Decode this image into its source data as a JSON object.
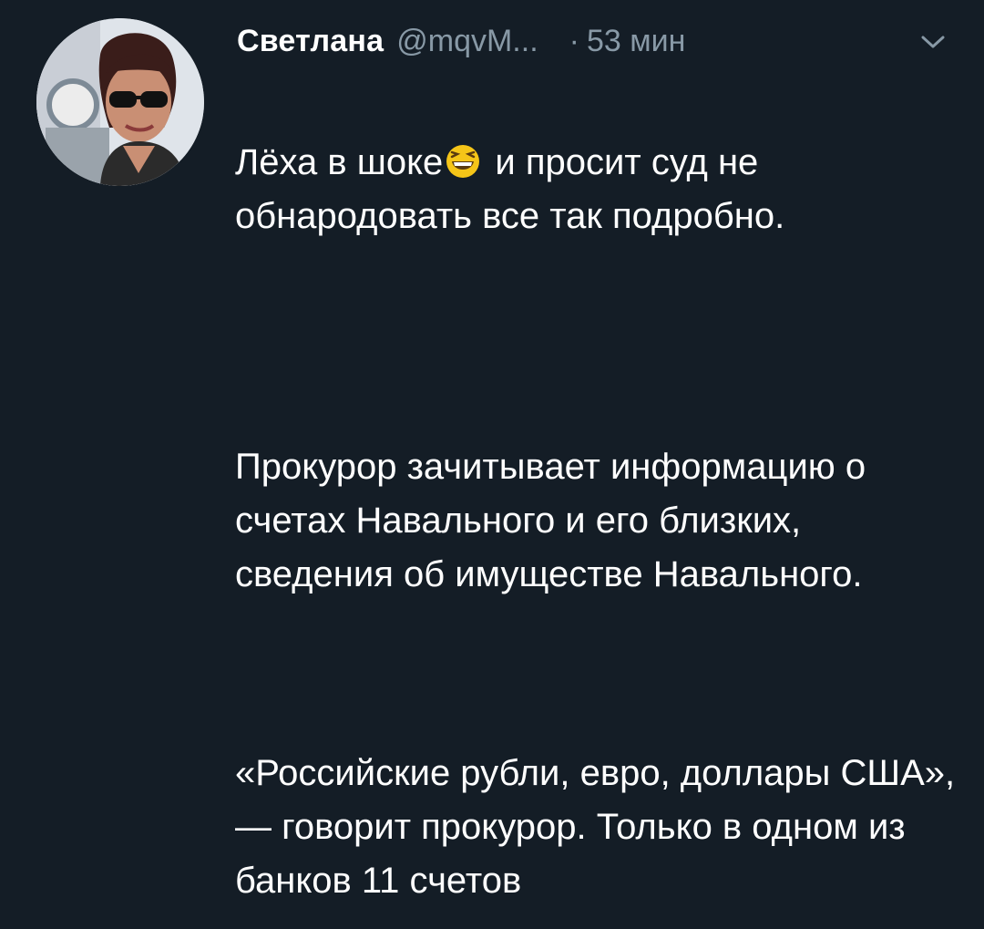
{
  "author": {
    "name": "Светлана",
    "handle": "@mqvM...",
    "separator": "·",
    "time": "53 мин"
  },
  "icons": {
    "menu": "chevron-down-icon",
    "avatar": "avatar",
    "emoji": "grinning-squinting-face-icon"
  },
  "tweet": {
    "line1_before": "Лёха в шоке",
    "line1_after": " и просит суд не обнародовать все так подробно.",
    "paragraph2": "Прокурор зачитывает информацию о счетах Навального и его близких, сведения об имуществе Навального.",
    "paragraph3": "«Российские рубли, евро, доллары США», — говорит прокурор. Только в одном из банков 11 счетов"
  },
  "colors": {
    "background": "#141d26",
    "text": "#ffffff",
    "muted": "#8899a6",
    "emoji": "#f5c518"
  }
}
